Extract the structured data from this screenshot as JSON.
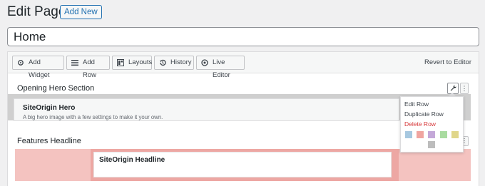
{
  "header": {
    "title": "Edit Page",
    "add_new_label": "Add New"
  },
  "post_title": {
    "value": "Home"
  },
  "toolbar": {
    "buttons": [
      {
        "label": "Add Widget",
        "icon": "add-widget-icon"
      },
      {
        "label": "Add Row",
        "icon": "add-row-icon"
      },
      {
        "label": "Layouts",
        "icon": "layouts-icon"
      },
      {
        "label": "History",
        "icon": "history-icon"
      },
      {
        "label": "Live Editor",
        "icon": "eye-icon"
      }
    ],
    "revert_label": "Revert to Editor"
  },
  "rows": [
    {
      "label": "Opening Hero Section",
      "widget": {
        "title": "SiteOrigin Hero",
        "description": "A big hero image with a few settings to make it your own."
      }
    },
    {
      "label": "Features Headline",
      "widget": {
        "title": "SiteOrigin Headline"
      }
    }
  ],
  "row_menu": {
    "items": [
      "Edit Row",
      "Duplicate Row",
      "Delete Row"
    ],
    "swatch_colors": [
      "#a7c8e0",
      "#f0a5a0",
      "#c4a8d8",
      "#a9dba0",
      "#e0d68a",
      "#bdbdbd"
    ]
  }
}
